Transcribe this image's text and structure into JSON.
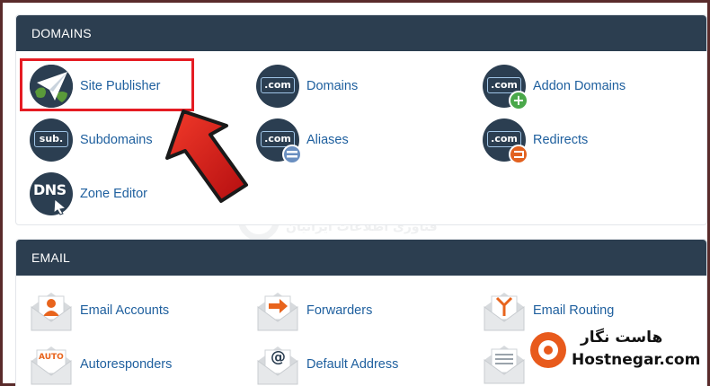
{
  "domains": {
    "header": "DOMAINS",
    "items": [
      {
        "label": "Site Publisher",
        "icon": "paper-plane-globe-icon"
      },
      {
        "label": "Domains",
        "icon": "dot-com-icon"
      },
      {
        "label": "Addon Domains",
        "icon": "dot-com-plus-icon"
      },
      {
        "label": "Subdomains",
        "icon": "sub-domain-icon"
      },
      {
        "label": "Aliases",
        "icon": "dot-com-minus-icon"
      },
      {
        "label": "Redirects",
        "icon": "dot-com-redirect-icon"
      },
      {
        "label": "Zone Editor",
        "icon": "dns-icon"
      }
    ],
    "icon_text": {
      "com": ".com",
      "sub": "sub.",
      "dns": "DNS"
    }
  },
  "email": {
    "header": "EMAIL",
    "items": [
      {
        "label": "Email Accounts",
        "icon": "envelope-user-icon"
      },
      {
        "label": "Forwarders",
        "icon": "envelope-arrow-icon"
      },
      {
        "label": "Email Routing",
        "icon": "envelope-fork-icon"
      },
      {
        "label": "Autoresponders",
        "icon": "envelope-auto-icon"
      },
      {
        "label": "Default Address",
        "icon": "envelope-at-icon"
      }
    ],
    "icon_text": {
      "auto": "AUTO",
      "at": "@"
    }
  },
  "branding": {
    "name_fa": "هاست نگار",
    "site": "Hostnegar.com",
    "watermark_title": "هاست نگار",
    "watermark_sub": "فناوری اطلاعات ایرانیان"
  },
  "colors": {
    "header_bg": "#2c3e50",
    "link": "#1e5f9e",
    "icon_dark": "#2b3e51",
    "highlight": "#e51c23",
    "plus_green": "#4aa84a",
    "minus_blue": "#6a8fc0",
    "redirect_orange": "#e2611f",
    "email_orange": "#e8641d"
  }
}
